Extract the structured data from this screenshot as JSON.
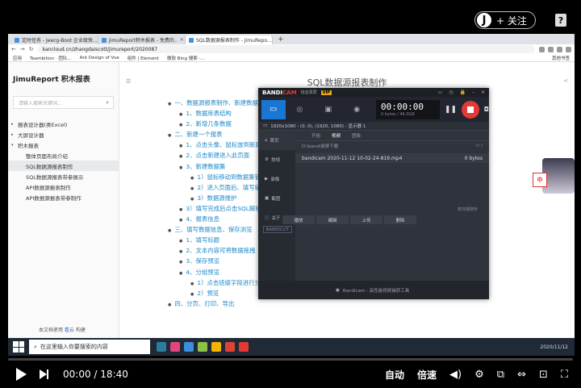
{
  "overlay": {
    "avatar_letter": "J",
    "follow_label": "+ 关注",
    "help_label": "?"
  },
  "browser": {
    "tabs": [
      {
        "label": "定时任务 - Jeecg-Boot 企业级快...",
        "active": false
      },
      {
        "label": "JimuReport积木报表 - 免费的..",
        "active": false
      },
      {
        "label": "SQL数据源报表制作 - JimuRepo...",
        "active": true
      }
    ],
    "new_tab": "+",
    "url": "kancloud.cn/zhangdaiscott/jimureport/2020087",
    "bookmarks": [
      "应用",
      "Teambition · 团队...",
      "Ant Design of Vue",
      "组件 | Element",
      "微软 Bing 搜索 -..."
    ],
    "bookmarks_right": "其他书签"
  },
  "sidebar": {
    "brand": "JimuReport 积木报表",
    "search_placeholder": "请输入搜索关键词...",
    "items": [
      {
        "label": "报表设计器(类Excel)",
        "arrow": "▸",
        "sub": false,
        "active": false
      },
      {
        "label": "大屏设计器",
        "arrow": "▸",
        "sub": false,
        "active": false
      },
      {
        "label": "积木报表",
        "arrow": "▾",
        "sub": false,
        "active": false
      },
      {
        "label": "整体页面布局介绍",
        "arrow": "",
        "sub": true,
        "active": false
      },
      {
        "label": "SQL数据源报表制作",
        "arrow": "",
        "sub": true,
        "active": true
      },
      {
        "label": "SQL数据源报表带参展示",
        "arrow": "",
        "sub": true,
        "active": false
      },
      {
        "label": "API数据源报表制作",
        "arrow": "",
        "sub": true,
        "active": false
      },
      {
        "label": "API数据源报表带参制作",
        "arrow": "",
        "sub": true,
        "active": false
      }
    ],
    "footer_prefix": "本文档使用 ",
    "footer_link": "看云",
    "footer_suffix": " 构建"
  },
  "content": {
    "title": "SQL数据源报表制作",
    "toc": [
      {
        "label": "一、数据源报表制作、新建数据库",
        "level": 1
      },
      {
        "label": "1、数据库表结构",
        "level": 2
      },
      {
        "label": "2、新增几条数据",
        "level": 2
      },
      {
        "label": "二、新建一个报表",
        "level": 1
      },
      {
        "label": "1、点击头像、鼠标放到新建",
        "level": 2
      },
      {
        "label": "2、点击新建进入此页面",
        "level": 2
      },
      {
        "label": "3、新建数据集",
        "level": 2
      },
      {
        "label": "1）鼠标移动到数据集管理",
        "level": 3
      },
      {
        "label": "2）进入页面后、填写编",
        "level": 3
      },
      {
        "label": "3）数据源维护",
        "level": 3
      },
      {
        "label": "3）填写完成后点击SQL解析",
        "level": 2
      },
      {
        "label": "4、报表信息",
        "level": 2
      },
      {
        "label": "三、填写数据信息、保存浏览",
        "level": 1
      },
      {
        "label": "1、填写标题",
        "level": 2
      },
      {
        "label": "2、文本内容可将数据拖拽",
        "level": 2
      },
      {
        "label": "3、保存预览",
        "level": 2
      },
      {
        "label": "4、分组预览",
        "level": 2
      },
      {
        "label": "1）点击班级字段进行分组",
        "level": 3
      },
      {
        "label": "2）预览",
        "level": 3
      },
      {
        "label": "四、分页、打印、导出",
        "level": 1
      }
    ]
  },
  "bandicam": {
    "logo_a": "BANDI",
    "logo_b": "CAM",
    "subtitle": "班迪录屏",
    "vip": "VIP",
    "timer": "00:00:00",
    "size": "0 bytes / 46.0GB",
    "resolution": "1920x1080 - (0, 0), (1920, 1080) - 显示器 1",
    "nav": [
      "首页",
      "常规",
      "录像",
      "截图",
      "关于"
    ],
    "tabs": [
      "开始",
      "视频",
      "图像"
    ],
    "path": "D:\\bandi录屏下载",
    "file_name": "bandicam 2020-11-12 10-02-24-819.mp4",
    "file_size": "0 bytes",
    "open_label": "按日期排序",
    "actions": [
      "播放",
      "编辑",
      "上传",
      "删除"
    ],
    "cut_label": "BANDICUT",
    "footer": "Bandicam - 高性能视频捕获工具"
  },
  "stickers": {
    "cn_label": "中"
  },
  "taskbar": {
    "search_placeholder": "在这里输入你要搜索的内容",
    "tray": "2020/11/12"
  },
  "video": {
    "current": "00:00",
    "separator": "/",
    "total": "18:40",
    "auto_label": "自动",
    "speed_label": "倍速"
  }
}
